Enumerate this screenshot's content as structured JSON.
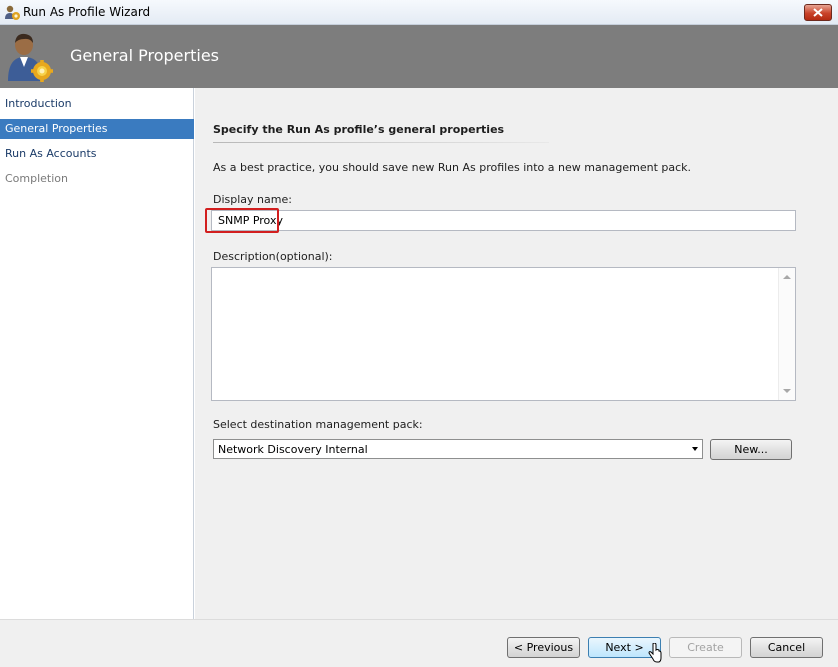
{
  "window": {
    "title": "Run As Profile Wizard",
    "close_label": "✕"
  },
  "header": {
    "title": "General Properties"
  },
  "nav": {
    "items": [
      {
        "label": "Introduction",
        "state": "normal"
      },
      {
        "label": "General Properties",
        "state": "active"
      },
      {
        "label": "Run As Accounts",
        "state": "normal"
      },
      {
        "label": "Completion",
        "state": "disabled"
      }
    ]
  },
  "main": {
    "section_title": "Specify the Run As profile’s general properties",
    "hint": "As a best practice, you should save new Run As profiles into a new management pack.",
    "display_name": {
      "label": "Display name:",
      "value": "SNMP Proxy"
    },
    "description": {
      "label": "Description(optional):",
      "value": ""
    },
    "destination": {
      "label": "Select destination management pack:",
      "value": "Network Discovery Internal",
      "new_button_label": "New..."
    }
  },
  "footer": {
    "previous_label": "< Previous",
    "next_label": "Next >",
    "create_label": "Create",
    "cancel_label": "Cancel"
  },
  "colors": {
    "header_band": "#7d7d7d",
    "nav_active": "#3a7bc0",
    "highlight": "#d21f1f"
  }
}
